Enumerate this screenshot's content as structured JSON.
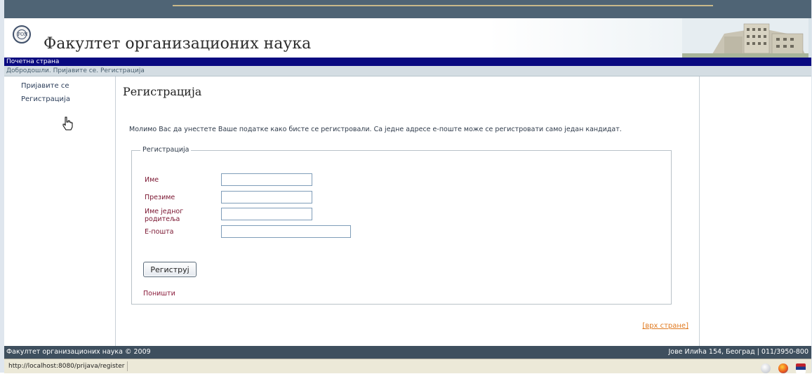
{
  "header": {
    "site_title": "Факултет организационих наука",
    "logo_text": "FON"
  },
  "nav": {
    "home": "Почетна страна"
  },
  "breadcrumb": "Добродошли. Пријавите се. Регистрација",
  "sidebar": {
    "items": [
      {
        "label": "Пријавите се"
      },
      {
        "label": "Регистрација"
      }
    ]
  },
  "main": {
    "title": "Регистрација",
    "intro": "Молимо Вас да унестете Ваше податке како бисте се регистровали. Са једне адресе е-поште може се регистровати само један кандидат.",
    "form": {
      "legend": "Регистрација",
      "fields": [
        {
          "label": "Име",
          "value": ""
        },
        {
          "label": "Презиме",
          "value": ""
        },
        {
          "label": "Име једног родитеља",
          "value": ""
        },
        {
          "label": "Е-пошта",
          "value": ""
        }
      ],
      "submit_label": "Региструј",
      "reset_label": "Поништи"
    },
    "back_to_top": "[врх стране]"
  },
  "footer": {
    "left": "Факултет организационих наука © 2009",
    "right": "Јове Илића 154, Београд | 011/3950-800"
  },
  "statusbar": {
    "url": "http://localhost:8080/prijava/register"
  },
  "colors": {
    "nav_bg": "#0a0a80",
    "footer_bg": "#3e4f5e",
    "label_color": "#7a1530",
    "link_accent": "#e07a20"
  },
  "icons": [
    "pointer-hand-icon",
    "globe-status-icon",
    "firefox-status-icon",
    "flag-status-icon"
  ]
}
